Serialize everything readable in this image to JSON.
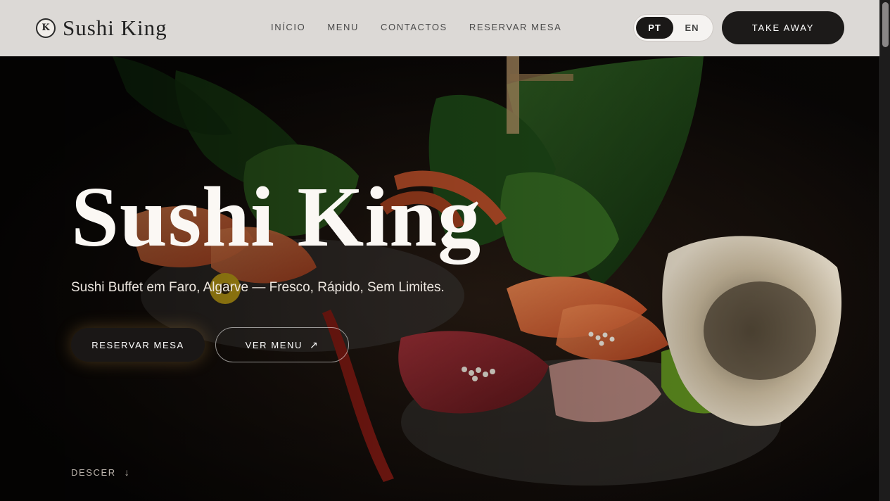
{
  "header": {
    "brand": "Sushi King",
    "logo_letter": "K",
    "nav": [
      {
        "label": "INÍCIO"
      },
      {
        "label": "MENU"
      },
      {
        "label": "CONTACTOS"
      },
      {
        "label": "RESERVAR MESA"
      }
    ],
    "languages": [
      {
        "label": "PT",
        "active": true
      },
      {
        "label": "EN",
        "active": false
      }
    ],
    "takeaway_label": "TAKE AWAY"
  },
  "hero": {
    "title": "Sushi King",
    "subtitle": "Sushi Buffet em Faro, Algarve — Fresco, Rápido, Sem Limites.",
    "primary_button": "RESERVAR MESA",
    "secondary_button": "VER MENU",
    "secondary_icon": "arrow-up-right-icon",
    "scroll_label": "DESCER",
    "scroll_icon": "arrow-down-icon"
  },
  "colors": {
    "header_bg": "#dcd9d6",
    "dark_button": "#1c1a19",
    "hero_text": "#fbf8f4"
  }
}
